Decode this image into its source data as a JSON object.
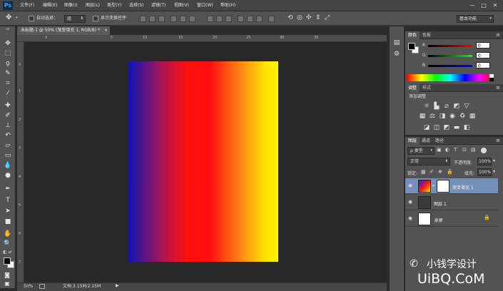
{
  "app": {
    "logo": "Ps"
  },
  "menu": [
    "文件(F)",
    "编辑(E)",
    "图像(I)",
    "图层(L)",
    "类型(Y)",
    "选择(S)",
    "滤镜(T)",
    "视图(V)",
    "窗口(W)",
    "帮助(H)"
  ],
  "window_controls": {
    "minimize": "—",
    "maximize": "□",
    "close": "✕"
  },
  "options_bar": {
    "auto_select_label": "自动选择：",
    "auto_select_value": "组",
    "show_transform_label": "显示变换控件",
    "workspace": "基本功能"
  },
  "document": {
    "tab_title": "未标题-1 @ 50% (渐变填充 1, RGB/8) *",
    "close": "×",
    "ruler_top": [
      "0",
      "5",
      "10",
      "15",
      "20",
      "25",
      "30",
      "35"
    ],
    "ruler_left": [
      "0",
      "1",
      "2",
      "3",
      "4",
      "5",
      "6",
      "7"
    ],
    "zoom": "50%",
    "doc_size": "文档:2.15M/2.15M"
  },
  "color_panel": {
    "tabs": [
      "颜色",
      "色板"
    ],
    "channels": [
      {
        "label": "R",
        "value": "0",
        "color": "#ff2020"
      },
      {
        "label": "G",
        "value": "0",
        "color": "#20e020"
      },
      {
        "label": "B",
        "value": "0",
        "color": "#2050ff"
      }
    ]
  },
  "adjustments_panel": {
    "tabs": [
      "调整",
      "样式"
    ],
    "title": "添加调整",
    "row1_icons": [
      "brightness-icon",
      "levels-icon",
      "curves-icon",
      "exposure-icon",
      "vibrance-icon"
    ],
    "row2_icons": [
      "hue-saturation-icon",
      "color-balance-icon",
      "black-white-icon",
      "photo-filter-icon",
      "channel-mixer-icon",
      "color-lookup-icon"
    ],
    "row3_icons": [
      "invert-icon",
      "posterize-icon",
      "threshold-icon",
      "gradient-map-icon",
      "selective-color-icon"
    ]
  },
  "layers_panel": {
    "tabs": [
      "图层",
      "通道",
      "路径"
    ],
    "filter_kind": "ρ 类型",
    "blend_mode": "正常",
    "opacity_label": "不透明度:",
    "opacity_value": "100%",
    "lock_label": "锁定:",
    "fill_label": "填充:",
    "fill_value": "100%",
    "layers": [
      {
        "name": "渐变填充 1",
        "selected": true
      },
      {
        "name": "图层 1",
        "selected": false
      },
      {
        "name": "背景",
        "selected": false
      }
    ]
  },
  "watermark": {
    "text": "小钱学设计",
    "url": "UiBQ.CoM"
  }
}
